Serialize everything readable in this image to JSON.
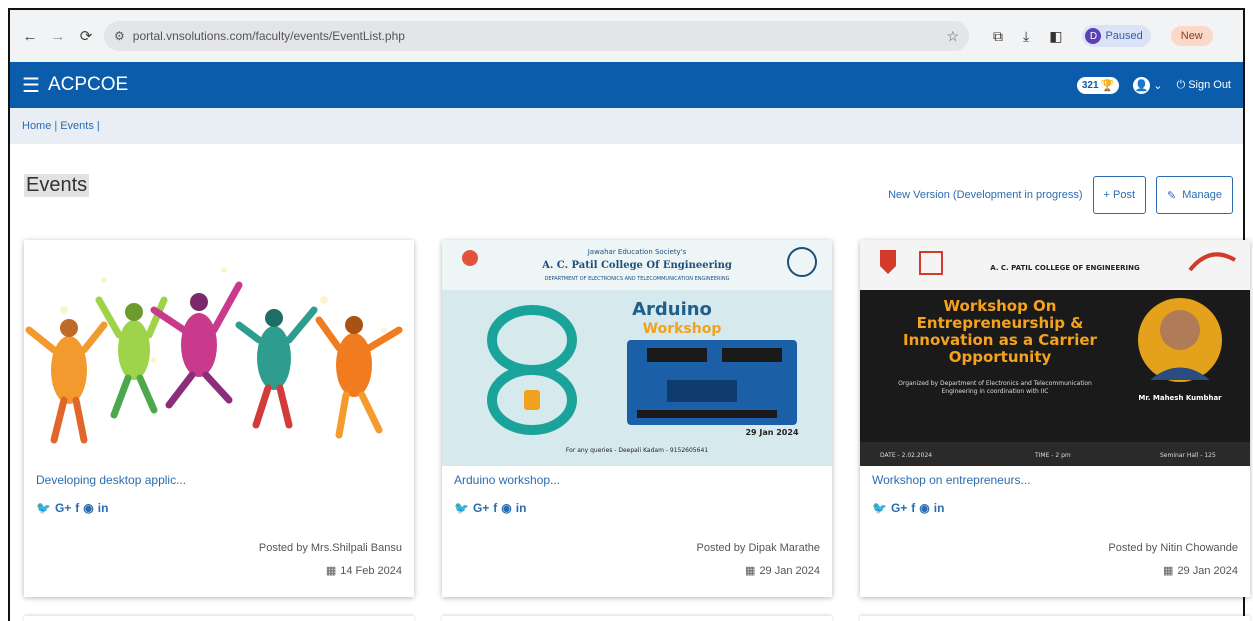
{
  "browser": {
    "url": "portal.vnsolutions.com/faculty/events/EventList.php",
    "profile_label": "Paused",
    "profile_initial": "D",
    "new_label": "New"
  },
  "app": {
    "brand": "ACPCOE",
    "points": "321",
    "signout_label": "Sign Out"
  },
  "breadcrumb": {
    "home": "Home",
    "sep": "|",
    "current": "Events",
    "trailing": "|"
  },
  "page": {
    "title": "Events",
    "new_version": "New Version (Development in progress)",
    "post_label": "+ Post",
    "manage_label": "Manage"
  },
  "cards": [
    {
      "title": "Developing desktop applic...",
      "posted_by": "Posted by Mrs.Shilpali Bansu",
      "date": "14 Feb 2024"
    },
    {
      "title": "Arduino workshop...",
      "posted_by": "Posted by Dipak Marathe",
      "date": "29 Jan 2024",
      "poster": {
        "society": "Jawahar Education Society's",
        "college": "A. C. Patil College Of Engineering",
        "dept": "DEPARTMENT OF ELECTRONICS AND TELECOMMUNICATION ENGINEERING",
        "line1": "Arduino",
        "line2": "Workshop",
        "date": "29 Jan 2024",
        "footer": "For any queries - Deepali Kadam - 9152605641"
      }
    },
    {
      "title": "Workshop on entrepreneurs...",
      "posted_by": "Posted by Nitin Chowande",
      "date": "29 Jan 2024",
      "poster": {
        "college": "A. C. PATIL COLLEGE OF ENGINEERING",
        "headline": "Workshop On Entrepreneurship & Innovation as a Carrier Opportunity",
        "subtitle": "Organized by Department of Electronics and Telecommunication Engineering in coordination with IIC",
        "speaker": "Mr. Mahesh Kumbhar",
        "date": "DATE - 2.02.2024",
        "time": "TIME - 2 pm",
        "venue": "Seminar Hall - 125"
      }
    }
  ],
  "colors": {
    "primary": "#0b5cab",
    "link": "#2b6cb0",
    "breadcrumb_bg": "#e9eef5"
  }
}
